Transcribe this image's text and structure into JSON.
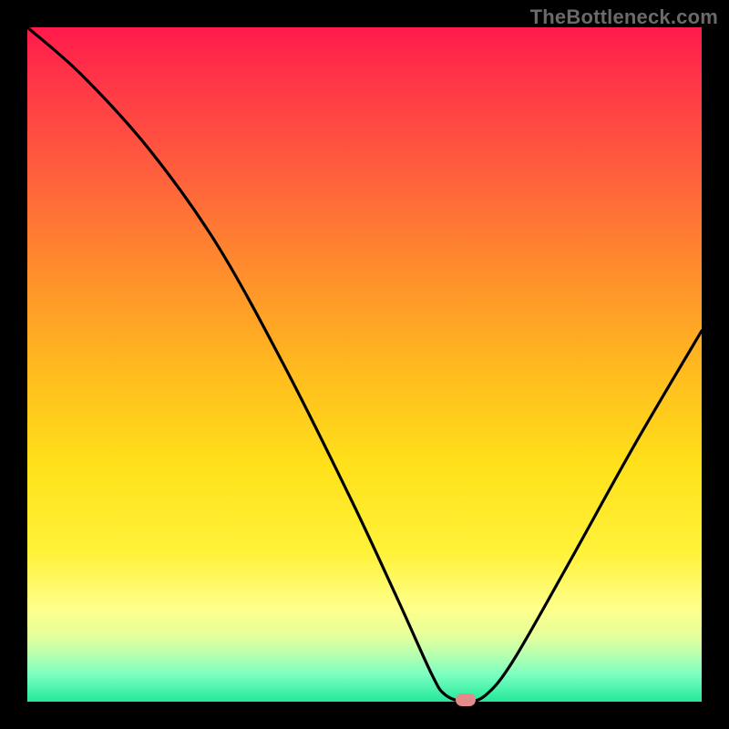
{
  "watermark": "TheBottleneck.com",
  "chart_data": {
    "type": "line",
    "title": "",
    "xlabel": "",
    "ylabel": "",
    "xlim": [
      0,
      100
    ],
    "ylim": [
      0,
      100
    ],
    "grid": false,
    "series": [
      {
        "name": "curve",
        "x": [
          0,
          8,
          18,
          28,
          38,
          48,
          55,
          60,
          62,
          65,
          68,
          72,
          80,
          90,
          100
        ],
        "values": [
          100,
          93,
          82,
          68,
          50,
          30,
          15,
          4,
          1,
          0,
          1,
          6,
          20,
          38,
          55
        ]
      }
    ],
    "marker": {
      "x": 65,
      "y": 0
    },
    "colors": {
      "curve": "#000000",
      "marker": "#e38a8a",
      "gradient_top": "#ff1a4b",
      "gradient_bottom": "#23e89a"
    }
  }
}
